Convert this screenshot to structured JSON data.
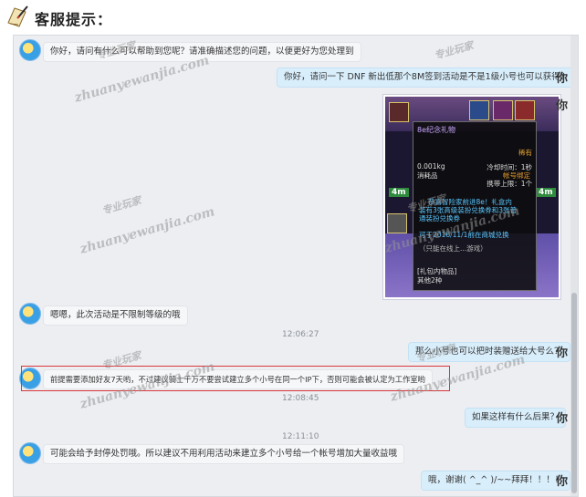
{
  "header": {
    "title": "客服提示：",
    "icon": "scroll-pen-icon"
  },
  "messages": [
    {
      "from": "cs",
      "text": "你好，请问有什么可以帮助到您呢？请准确描述您的问题，以便更好为您处理到"
    },
    {
      "from": "user",
      "text": "你好，请问一下  DNF 新出低那个8M签到活动是不是1级小号也可以获得？",
      "avatar": "你"
    },
    {
      "from": "cs",
      "text": "嗯嗯，此次活动是不限制等级的哦"
    },
    {
      "time": "12:06:27"
    },
    {
      "from": "user",
      "text": "那么小号也可以把时装赠送给大号么？",
      "avatar": "你"
    },
    {
      "from": "cs",
      "text": "前提需要添加好友7天哟，不过建议骑士千万不要尝试建立多个小号在同一个IP下，否则可能会被认定为工作室哟"
    },
    {
      "time": "12:08:45"
    },
    {
      "from": "user",
      "text": "如果这样有什么后果？",
      "avatar": "你"
    },
    {
      "time": "12:11:10"
    },
    {
      "from": "cs",
      "text": "可能会给予封停处罚哦。所以建议不用利用活动来建立多个小号给一个帐号增加大量收益哦"
    },
    {
      "from": "user",
      "text": "哦，谢谢( ^_^ )/~~拜拜！！！！",
      "avatar": "你"
    }
  ],
  "game_tooltip": {
    "title": "8e纪念礼物",
    "rarity": "稀有",
    "weight": "0.001kg",
    "type": "消耗品",
    "cooldown": "冷却时间：1秒",
    "bind": "帐号绑定",
    "hold": "携带上限：1个",
    "desc1": "恭喜冒险家前进8e！礼盒内",
    "desc2": "装有3张高级装扮兑换券和3张普",
    "desc3": "通装扮兑换券",
    "desc4": "可于2016/11/1前在商城兑换",
    "desc5": "（只能在线上...游戏）",
    "package": "[礼包内物品]",
    "other": "其他2种",
    "badge_left": "4m",
    "badge_right": "4m"
  },
  "watermark": {
    "line1": "专业玩家",
    "line2": "zhuanyewanjia.com"
  }
}
